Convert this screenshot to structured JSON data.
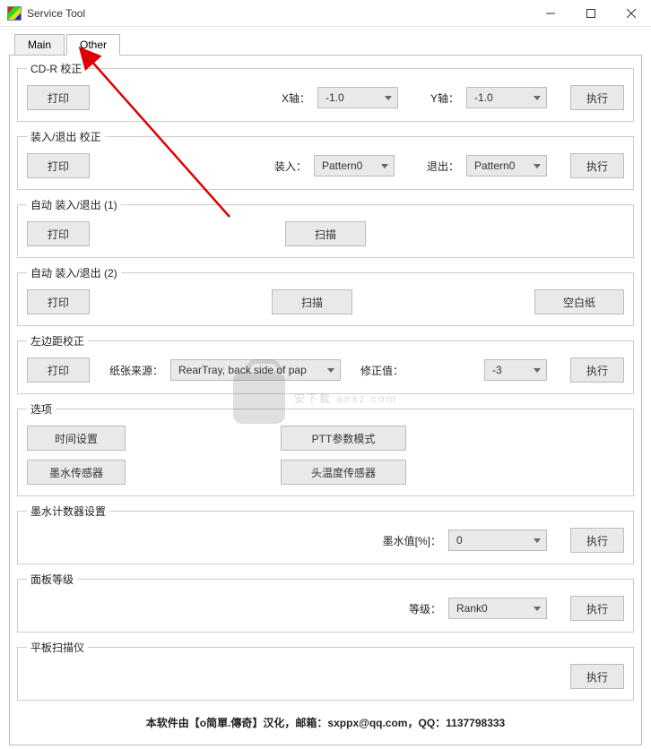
{
  "window": {
    "title": "Service Tool"
  },
  "tabs": {
    "main": "Main",
    "other": "Other"
  },
  "groups": {
    "cdr": {
      "legend": "CD-R 校正",
      "print": "打印",
      "xlabel": "X轴：",
      "xval": "-1.0",
      "ylabel": "Y轴：",
      "yval": "-1.0",
      "exec": "执行"
    },
    "inout": {
      "legend": "装入/退出 校正",
      "print": "打印",
      "inlabel": "装入：",
      "inval": "Pattern0",
      "outlabel": "退出：",
      "outval": "Pattern0",
      "exec": "执行"
    },
    "auto1": {
      "legend": "自动 装入/退出 (1)",
      "print": "打印",
      "scan": "扫描"
    },
    "auto2": {
      "legend": "自动 装入/退出 (2)",
      "print": "打印",
      "scan": "扫描",
      "blank": "空白纸"
    },
    "leftmargin": {
      "legend": "左边距校正",
      "print": "打印",
      "sourcelabel": "纸张来源：",
      "sourceval": "RearTray, back side of pap",
      "corrlabel": "修正值：",
      "corrval": "-3",
      "exec": "执行"
    },
    "options": {
      "legend": "选项",
      "time": "时间设置",
      "ptt": "PTT参数模式",
      "ink": "墨水传感器",
      "headtemp": "头温度传感器"
    },
    "inkcounter": {
      "legend": "墨水计数器设置",
      "label": "墨水值[%]：",
      "val": "0",
      "exec": "执行"
    },
    "panel": {
      "legend": "面板等级",
      "label": "等级：",
      "val": "Rank0",
      "exec": "执行"
    },
    "flatbed": {
      "legend": "平板扫描仪",
      "exec": "执行"
    }
  },
  "footer": "本软件由【o简單.傳奇】汉化，邮箱：sxppx@qq.com，QQ：1137798333",
  "watermark": "安下载  anxz.com"
}
